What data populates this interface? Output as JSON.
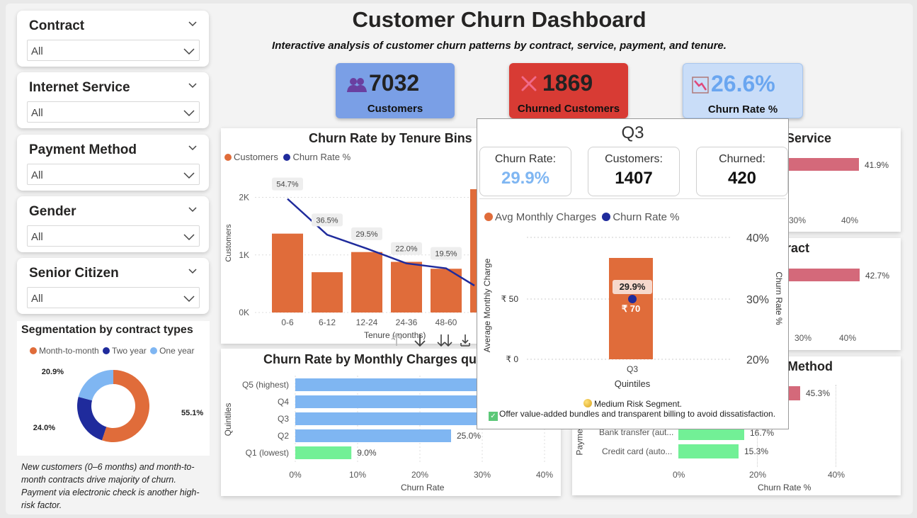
{
  "dashboard": {
    "title": "Customer Churn Dashboard",
    "subtitle": "Interactive analysis of customer churn patterns by contract, service, payment, and tenure."
  },
  "slicers": [
    {
      "label": "Contract",
      "value": "All"
    },
    {
      "label": "Internet Service",
      "value": "All"
    },
    {
      "label": "Payment Method",
      "value": "All"
    },
    {
      "label": "Gender",
      "value": "All"
    },
    {
      "label": "Senior Citizen",
      "value": "All"
    }
  ],
  "kpis": {
    "customers": {
      "value": "7032",
      "label": "Customers",
      "icon": "people-icon",
      "color": "#7a9fe6"
    },
    "churned": {
      "value": "1869",
      "label": "Churned Customers",
      "icon": "x-icon",
      "color": "#d83b34"
    },
    "churn_rate": {
      "value": "26.6%",
      "label": "Churn Rate %",
      "icon": "trend-down-icon",
      "color": "#c9ddf8"
    }
  },
  "segmentation": {
    "title": "Segmentation by contract types",
    "legend": [
      "Month-to-month",
      "Two year",
      "One year"
    ],
    "colors": [
      "#e06c3a",
      "#1f2b9c",
      "#7fb6f2"
    ],
    "labels": [
      "55.1%",
      "24.0%",
      "20.9%"
    ]
  },
  "note": "New customers (0–6 months) and month-to-month contracts drive majority of churn. Payment via electronic check is another high-risk factor.",
  "tenure_chart": {
    "title": "Churn Rate by Tenure Bins",
    "legend": [
      "Customers",
      "Churn Rate %"
    ],
    "y_label": "Customers",
    "x_label": "Tenure (months)",
    "y_ticks": [
      "2K",
      "1K",
      "0K"
    ],
    "categories": [
      "0-6",
      "6-12",
      "12-24",
      "24-36",
      "48-60"
    ],
    "rate_labels": [
      "54.7%",
      "36.5%",
      "29.5%",
      "22.0%",
      "19.5%"
    ]
  },
  "monthly_chart": {
    "title": "Churn Rate by Monthly Charges quintiles",
    "y_label": "Quintiles",
    "x_label": "Churn Rate",
    "categories": [
      "Q5 (highest)",
      "Q4",
      "Q3",
      "Q2",
      "Q1 (lowest)"
    ],
    "value_labels": [
      "25.0%",
      "9.0%"
    ],
    "x_ticks": [
      "0%",
      "10%",
      "20%",
      "30%",
      "40%"
    ]
  },
  "service_chart": {
    "title": "Service",
    "value_label": "41.9%",
    "x_ticks": [
      "30%",
      "40%"
    ]
  },
  "contract_chart": {
    "title": "ract",
    "value_label": "42.7%",
    "x_ticks": [
      "30%",
      "40%"
    ]
  },
  "payment_chart": {
    "title": "Method",
    "y_label": "Payme",
    "x_label": "Churn Rate %",
    "categories": [
      "Bank transfer (aut...",
      "Credit card (auto..."
    ],
    "value_labels": [
      "45.3%",
      "16.7%",
      "15.3%"
    ],
    "x_ticks": [
      "0%",
      "20%",
      "40%"
    ]
  },
  "tooltip": {
    "title": "Q3",
    "churn_rate_label": "Churn Rate:",
    "churn_rate_value": "29.9%",
    "customers_label": "Customers:",
    "customers_value": "1407",
    "churned_label": "Churned:",
    "churned_value": "420",
    "legend": [
      "Avg Monthly Charges",
      "Churn Rate %"
    ],
    "y_left_label": "Average Monthly Charge",
    "y_right_label": "Churn Rate %",
    "y_left_ticks": [
      "₹ 50",
      "₹ 0"
    ],
    "y_right_ticks": [
      "40%",
      "30%",
      "20%"
    ],
    "category": "Q3",
    "x_label": "Quintiles",
    "bar_label": "₹ 70",
    "rate_label": "29.9%",
    "segment": "Medium Risk Segment.",
    "recommendation": "Offer value-added bundles and transparent billing to avoid dissatisfaction."
  },
  "chart_data": [
    {
      "type": "pie",
      "title": "Segmentation by contract types",
      "categories": [
        "Month-to-month",
        "Two year",
        "One year"
      ],
      "values": [
        55.1,
        24.0,
        20.9
      ]
    },
    {
      "type": "bar",
      "title": "Churn Rate by Tenure Bins",
      "categories": [
        "0-6",
        "6-12",
        "12-24",
        "24-36",
        "48-60"
      ],
      "series": [
        {
          "name": "Customers",
          "values": [
            1370,
            700,
            1050,
            880,
            760
          ]
        },
        {
          "name": "Churn Rate %",
          "values": [
            54.7,
            36.5,
            29.5,
            22.0,
            19.5
          ]
        }
      ],
      "ylim": [
        0,
        2400
      ]
    },
    {
      "type": "bar",
      "title": "Churn Rate by Monthly Charges quintiles",
      "categories": [
        "Q5 (highest)",
        "Q4",
        "Q3",
        "Q2",
        "Q1 (lowest)"
      ],
      "values": [
        33,
        33,
        29.9,
        25.0,
        9.0
      ],
      "xlim": [
        0,
        40
      ]
    }
  ]
}
